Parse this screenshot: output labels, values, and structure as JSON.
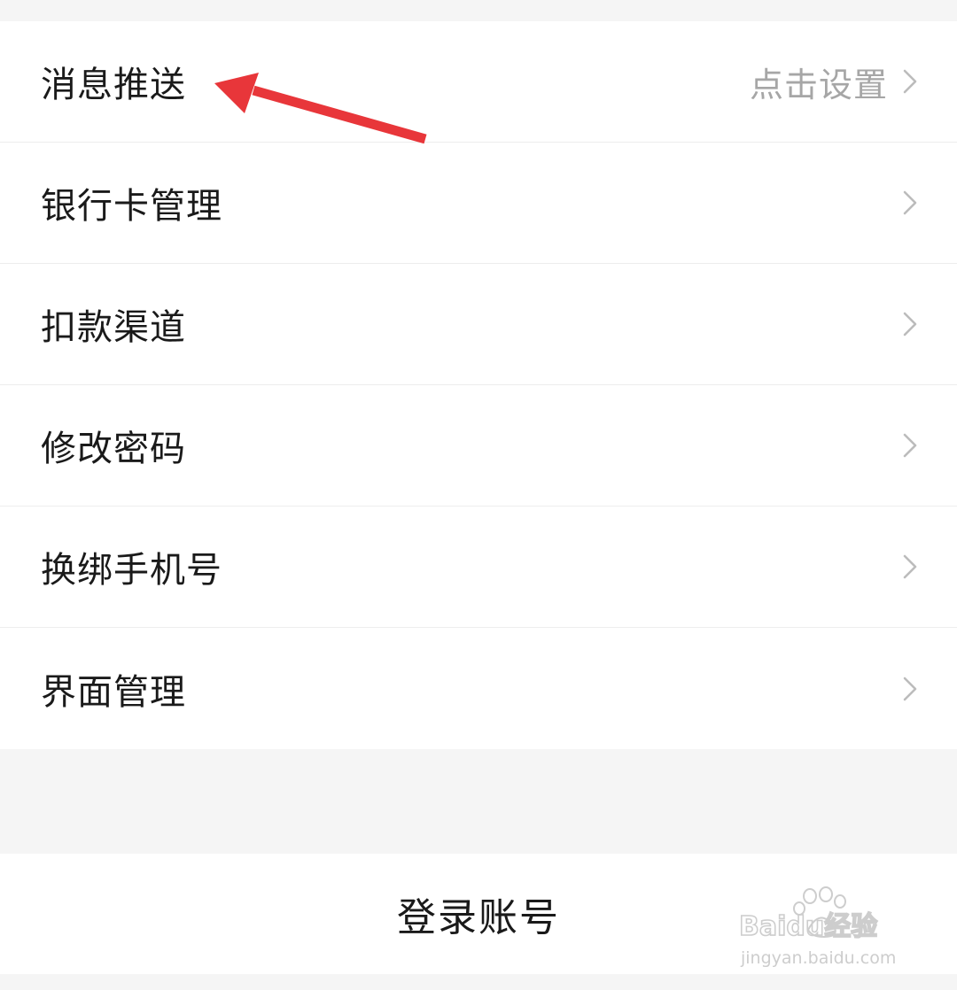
{
  "settings": {
    "items": [
      {
        "label": "消息推送",
        "value": "点击设置"
      },
      {
        "label": "银行卡管理",
        "value": ""
      },
      {
        "label": "扣款渠道",
        "value": ""
      },
      {
        "label": "修改密码",
        "value": ""
      },
      {
        "label": "换绑手机号",
        "value": ""
      },
      {
        "label": "界面管理",
        "value": ""
      }
    ]
  },
  "account": {
    "login_label": "登录账号"
  },
  "annotation": {
    "arrow_color": "#e8363a"
  },
  "watermark": {
    "brand": "Baidu经验",
    "url": "jingyan.baidu.com"
  },
  "colors": {
    "background": "#f5f5f5",
    "card": "#ffffff",
    "text_primary": "#1a1a1a",
    "text_secondary": "#a6a6a6",
    "chevron": "#bcbcbc"
  }
}
